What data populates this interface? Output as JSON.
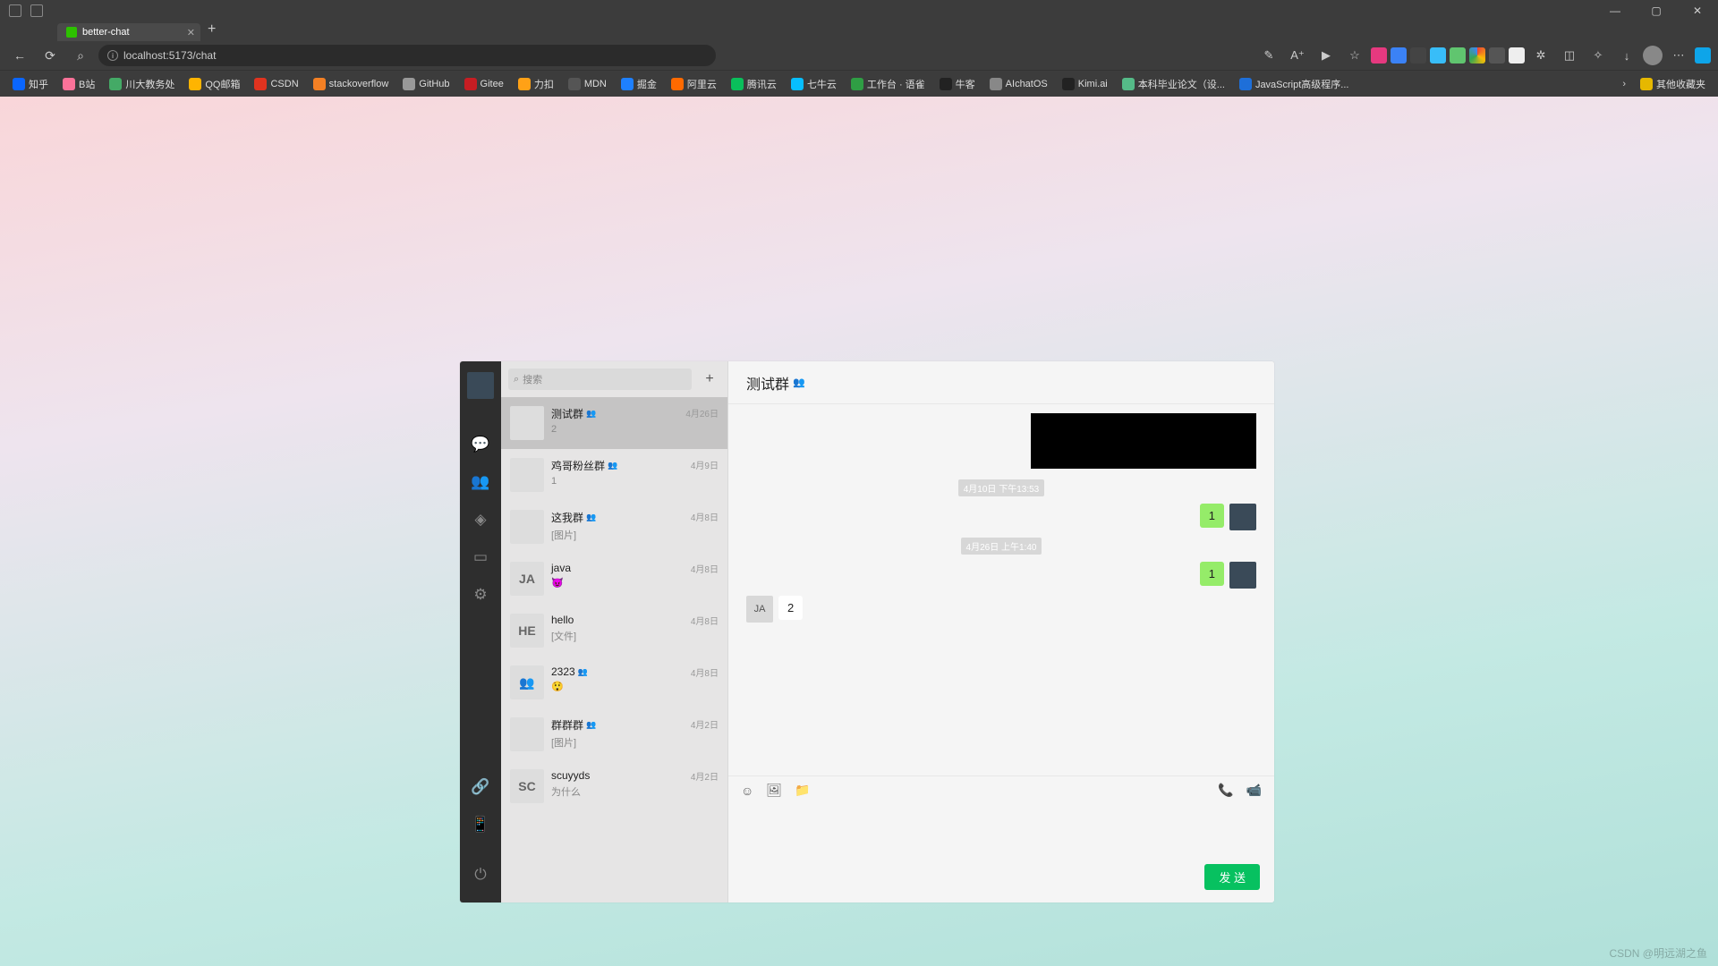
{
  "browser": {
    "tab_title": "better-chat",
    "url": "localhost:5173/chat",
    "win_min": "—",
    "win_max": "▢",
    "win_close": "✕",
    "bookmarks": [
      {
        "label": "知乎",
        "color": "#0a66ff"
      },
      {
        "label": "B站",
        "color": "#fb7299"
      },
      {
        "label": "川大教务处",
        "color": "#4a6"
      },
      {
        "label": "QQ邮箱",
        "color": "#ffb400"
      },
      {
        "label": "CSDN",
        "color": "#e1331f"
      },
      {
        "label": "stackoverflow",
        "color": "#f48024"
      },
      {
        "label": "GitHub",
        "color": "#999"
      },
      {
        "label": "Gitee",
        "color": "#c71d23"
      },
      {
        "label": "力扣",
        "color": "#ffa116"
      },
      {
        "label": "MDN",
        "color": "#555"
      },
      {
        "label": "掘金",
        "color": "#1e80ff"
      },
      {
        "label": "阿里云",
        "color": "#ff6a00"
      },
      {
        "label": "腾讯云",
        "color": "#0abf5b"
      },
      {
        "label": "七牛云",
        "color": "#07beff"
      },
      {
        "label": "工作台 · 语雀",
        "color": "#2f9e44"
      },
      {
        "label": "牛客",
        "color": "#222"
      },
      {
        "label": "AIchatOS",
        "color": "#888"
      },
      {
        "label": "Kimi.ai",
        "color": "#222"
      },
      {
        "label": "本科毕业论文（设...",
        "color": "#5b8"
      },
      {
        "label": "JavaScript高级程序...",
        "color": "#1e6fd9"
      }
    ],
    "other_folder": "其他收藏夹"
  },
  "chat": {
    "search_placeholder": "搜索",
    "header_title": "测试群",
    "send_label": "发 送",
    "conversations": [
      {
        "name": "测试群",
        "preview": "2",
        "date": "4月26日",
        "group": true,
        "av": "panda",
        "sel": true
      },
      {
        "name": "鸡哥粉丝群",
        "preview": "1",
        "date": "4月9日",
        "group": true,
        "av": "sky"
      },
      {
        "name": "这我群",
        "preview": "[图片]",
        "date": "4月8日",
        "group": true,
        "av": "crowd"
      },
      {
        "name": "java",
        "preview": "😈",
        "date": "4月8日",
        "av": "JA"
      },
      {
        "name": "hello",
        "preview": "[文件]",
        "date": "4月8日",
        "av": "HE"
      },
      {
        "name": "2323",
        "preview": "😲",
        "date": "4月8日",
        "group": true,
        "av": "green"
      },
      {
        "name": "群群群",
        "preview": "[图片]",
        "date": "4月2日",
        "group": true,
        "av": "crowd"
      },
      {
        "name": "scuyyds",
        "preview": "为什么",
        "date": "4月2日",
        "av": "SC"
      }
    ],
    "msgs": {
      "ts1": "4月10日 下午13:53",
      "m1": "1",
      "ts2": "4月26日 上午1:40",
      "m2": "1",
      "ja": "JA",
      "m3": "2"
    }
  },
  "watermark": "CSDN @明远湖之鱼"
}
